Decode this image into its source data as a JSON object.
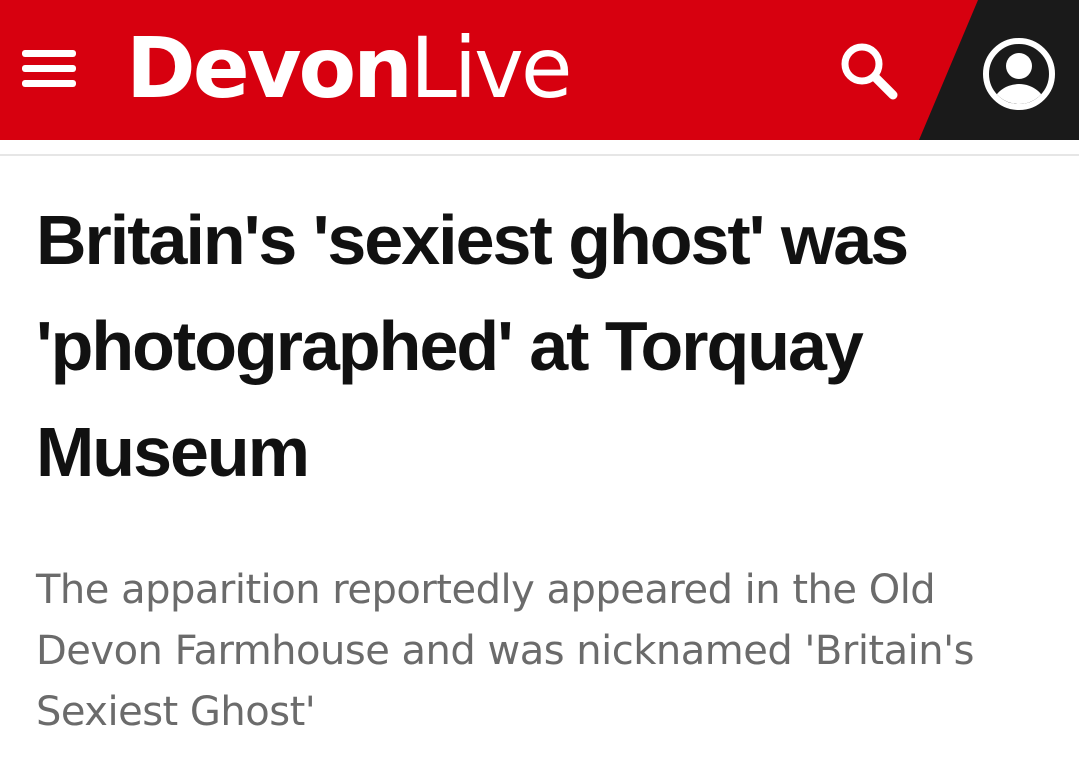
{
  "header": {
    "logo_bold": "Devon",
    "logo_light": "Live",
    "menu_icon": "hamburger-menu-icon",
    "search_icon": "search-icon",
    "account_icon": "user-account-icon",
    "brand_color": "#d7000f",
    "account_bg_color": "#1a1a1a"
  },
  "article": {
    "headline": "Britain's 'sexiest ghost' was 'photographed' at Torquay Museum",
    "standfirst": "The apparition reportedly appeared in the Old Devon Farmhouse and was nicknamed 'Britain's Sexiest Ghost'",
    "headline_color": "#111111",
    "standfirst_color": "#6b6b6b"
  }
}
